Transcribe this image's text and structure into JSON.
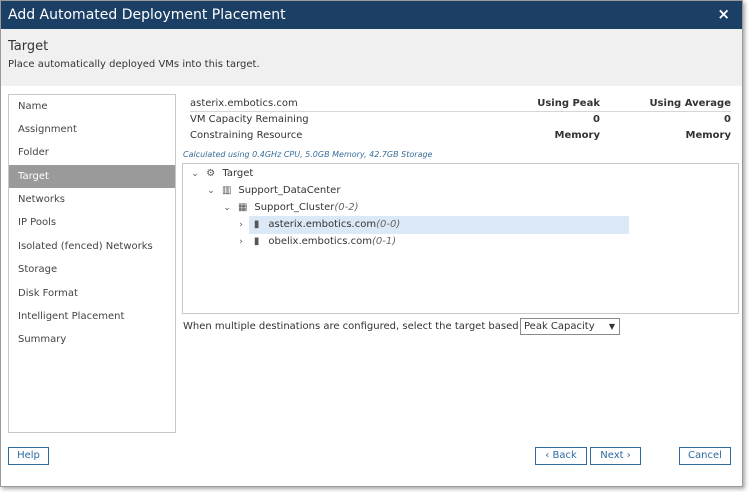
{
  "dialog": {
    "title": "Add Automated Deployment Placement",
    "close_icon": "×"
  },
  "header": {
    "title": "Target",
    "subtitle": "Place automatically deployed VMs into this target."
  },
  "nav": {
    "items": [
      {
        "label": "Name",
        "active": false
      },
      {
        "label": "Assignment",
        "active": false
      },
      {
        "label": "Folder",
        "active": false
      },
      {
        "label": "Target",
        "active": true
      },
      {
        "label": "Networks",
        "active": false
      },
      {
        "label": "IP Pools",
        "active": false
      },
      {
        "label": "Isolated (fenced) Networks",
        "active": false
      },
      {
        "label": "Storage",
        "active": false
      },
      {
        "label": "Disk Format",
        "active": false
      },
      {
        "label": "Intelligent Placement",
        "active": false
      },
      {
        "label": "Summary",
        "active": false
      }
    ]
  },
  "capacity": {
    "host": "asterix.embotics.com",
    "col_peak": "Using Peak",
    "col_avg": "Using Average",
    "rows": [
      {
        "label": "VM Capacity Remaining",
        "peak": "0",
        "avg": "0"
      },
      {
        "label": "Constraining Resource",
        "peak": "Memory",
        "avg": "Memory"
      }
    ],
    "calc_note": "Calculated using 0.4GHz CPU, 5.0GB Memory, 42.7GB Storage"
  },
  "tree": {
    "nodes": [
      {
        "chevron": "⌄",
        "icon": "gear-icon",
        "glyph": "⚙",
        "label": "Target",
        "count": ""
      },
      {
        "chevron": "⌄",
        "icon": "datacenter-icon",
        "glyph": "▥",
        "label": "Support_DataCenter",
        "count": ""
      },
      {
        "chevron": "⌄",
        "icon": "cluster-icon",
        "glyph": "▦",
        "label": "Support_Cluster",
        "count": "(0-2)"
      },
      {
        "chevron": "›",
        "icon": "host-icon",
        "glyph": "▮",
        "label": "asterix.embotics.com",
        "count": "(0-0)"
      },
      {
        "chevron": "›",
        "icon": "host-icon",
        "glyph": "▮",
        "label": "obelix.embotics.com",
        "count": "(0-1)"
      }
    ]
  },
  "strategy": {
    "label": "When multiple destinations are configured, select the target based on:",
    "selected": "Peak Capacity"
  },
  "buttons": {
    "help": "Help",
    "back": "Back",
    "back_icon": "‹",
    "next": "Next",
    "next_icon": "›",
    "cancel": "Cancel"
  },
  "colors": {
    "titlebar": "#1c3f66",
    "selected_nav": "#9a9a9a",
    "button_accent": "#2d6aa0",
    "tree_selection": "#dbe8f5"
  }
}
